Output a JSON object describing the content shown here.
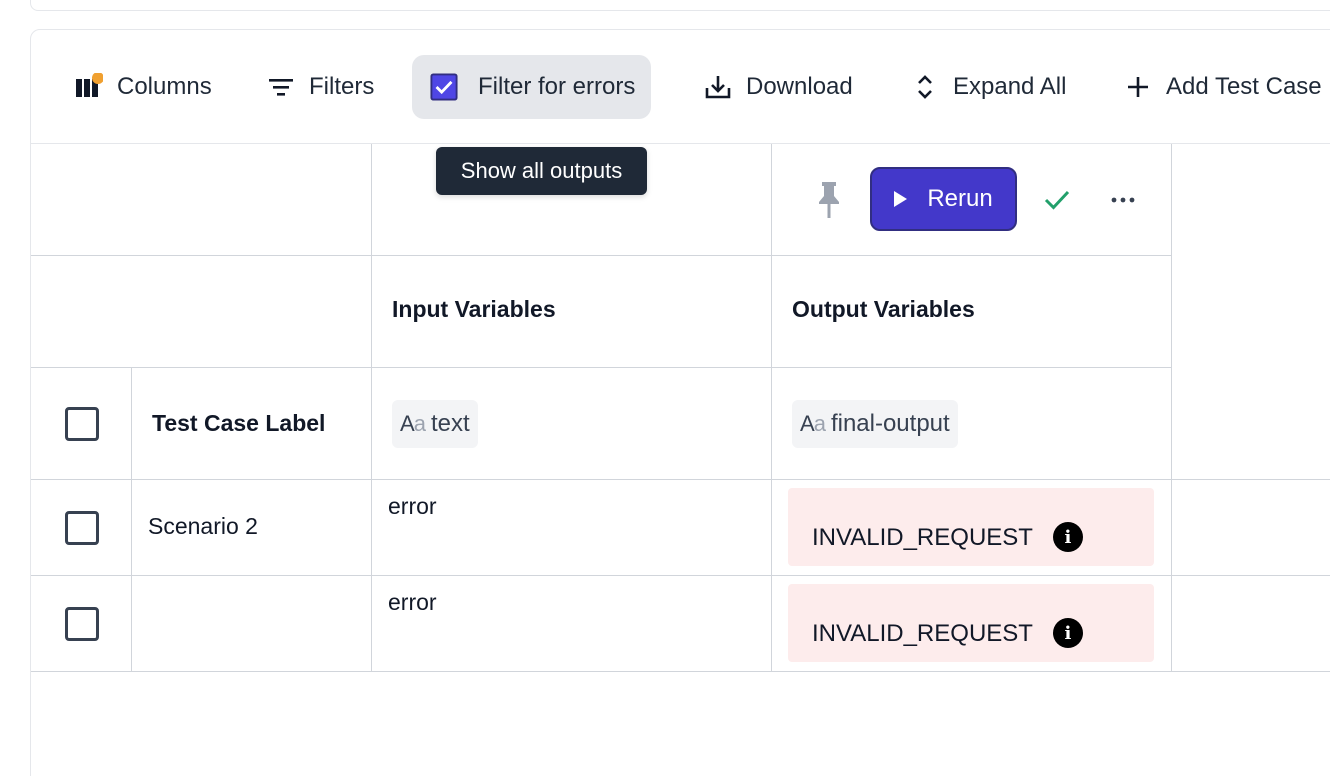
{
  "toolbar": {
    "columns_label": "Columns",
    "filters_label": "Filters",
    "filter_errors_label": "Filter for errors",
    "filter_errors_checked": true,
    "download_label": "Download",
    "expand_all_label": "Expand All",
    "add_test_case_label": "Add Test Case"
  },
  "tooltip": {
    "text": "Show all outputs"
  },
  "run_controls": {
    "rerun_label": "Rerun",
    "status": "success"
  },
  "table": {
    "headers": {
      "input": "Input Variables",
      "output": "Output Variables"
    },
    "label_header": "Test Case Label",
    "input_variable": {
      "type_icon": "Aa",
      "name": "text"
    },
    "output_variable": {
      "type_icon": "Aa",
      "name": "final-output"
    },
    "rows": [
      {
        "label": "Scenario 2",
        "input": "error",
        "output": "INVALID_REQUEST"
      },
      {
        "label": "",
        "input": "error",
        "output": "INVALID_REQUEST"
      }
    ]
  },
  "colors": {
    "accent": "#4338ca",
    "checkbox_fill": "#4f46e5",
    "error_bg": "#fdecec",
    "success": "#22a06b",
    "columns_badge": "#f0a030"
  }
}
